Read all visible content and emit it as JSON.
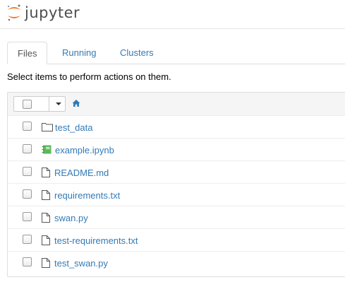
{
  "header": {
    "brand": "jupyter"
  },
  "tabs": [
    {
      "label": "Files",
      "active": true
    },
    {
      "label": "Running",
      "active": false
    },
    {
      "label": "Clusters",
      "active": false
    }
  ],
  "instructions": "Select items to perform actions on them.",
  "file_list": {
    "items": [
      {
        "name": "test_data",
        "icon": "folder-icon"
      },
      {
        "name": "example.ipynb",
        "icon": "notebook-icon"
      },
      {
        "name": "README.md",
        "icon": "file-icon"
      },
      {
        "name": "requirements.txt",
        "icon": "file-icon"
      },
      {
        "name": "swan.py",
        "icon": "file-icon"
      },
      {
        "name": "test-requirements.txt",
        "icon": "file-icon"
      },
      {
        "name": "test_swan.py",
        "icon": "file-icon"
      }
    ]
  },
  "colors": {
    "link": "#337ab7",
    "logo_orange": "#f37726",
    "notebook_green": "#5cb85c"
  }
}
